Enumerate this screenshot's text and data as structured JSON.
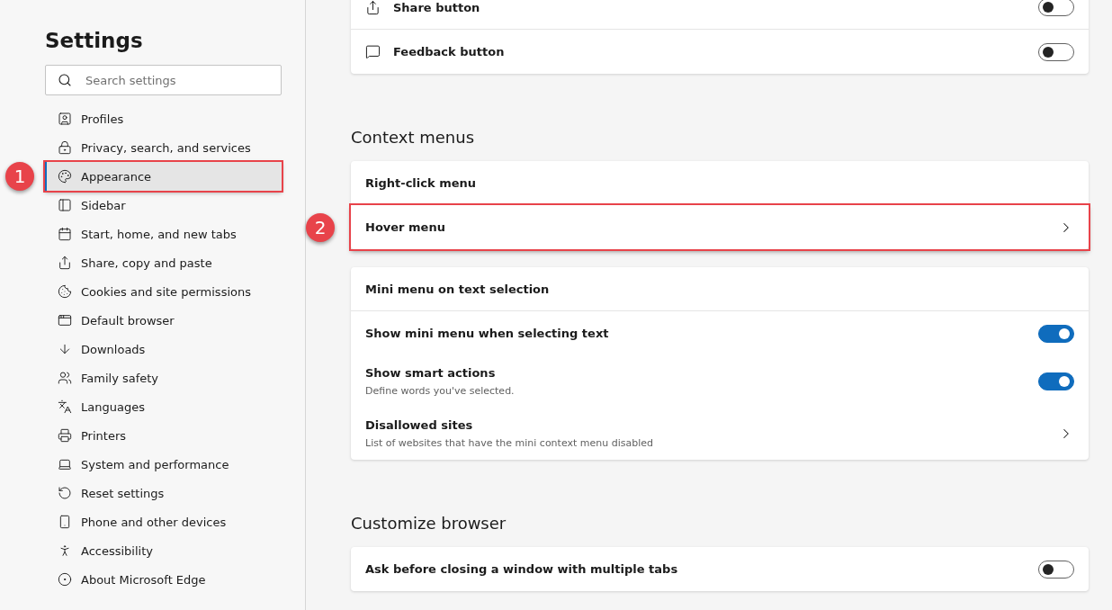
{
  "sidebar": {
    "title": "Settings",
    "search": {
      "placeholder": "Search settings"
    },
    "items": [
      {
        "label": "Profiles",
        "selected": false
      },
      {
        "label": "Privacy, search, and services",
        "selected": false
      },
      {
        "label": "Appearance",
        "selected": true,
        "highlighted": true,
        "callout": "1"
      },
      {
        "label": "Sidebar",
        "selected": false
      },
      {
        "label": "Start, home, and new tabs",
        "selected": false
      },
      {
        "label": "Share, copy and paste",
        "selected": false
      },
      {
        "label": "Cookies and site permissions",
        "selected": false
      },
      {
        "label": "Default browser",
        "selected": false
      },
      {
        "label": "Downloads",
        "selected": false
      },
      {
        "label": "Family safety",
        "selected": false
      },
      {
        "label": "Languages",
        "selected": false
      },
      {
        "label": "Printers",
        "selected": false
      },
      {
        "label": "System and performance",
        "selected": false
      },
      {
        "label": "Reset settings",
        "selected": false
      },
      {
        "label": "Phone and other devices",
        "selected": false
      },
      {
        "label": "Accessibility",
        "selected": false
      },
      {
        "label": "About Microsoft Edge",
        "selected": false
      }
    ]
  },
  "sections": [
    {
      "cards": [
        {
          "rows": [
            {
              "kind": "toggle",
              "label": "Share button",
              "on": false
            },
            {
              "kind": "toggle",
              "label": "Feedback button",
              "on": false
            }
          ]
        }
      ]
    },
    {
      "heading": "Context menus",
      "cards": [
        {
          "rows": [
            {
              "kind": "plain",
              "label": "Right-click menu"
            },
            {
              "kind": "link",
              "label": "Hover menu",
              "highlighted": true,
              "callout": "2"
            }
          ]
        },
        {
          "rows": [
            {
              "kind": "header",
              "label": "Mini menu on text selection"
            },
            {
              "kind": "toggle",
              "label": "Show mini menu when selecting text",
              "on": true
            },
            {
              "kind": "toggle",
              "label": "Show smart actions",
              "on": true,
              "description": "Define words you've selected."
            },
            {
              "kind": "link",
              "label": "Disallowed sites",
              "description": "List of websites that have the mini context menu disabled"
            }
          ]
        }
      ]
    },
    {
      "heading": "Customize browser",
      "cards": [
        {
          "rows": [
            {
              "kind": "toggle",
              "label": "Ask before closing a window with multiple tabs",
              "on": false
            }
          ]
        }
      ]
    }
  ]
}
